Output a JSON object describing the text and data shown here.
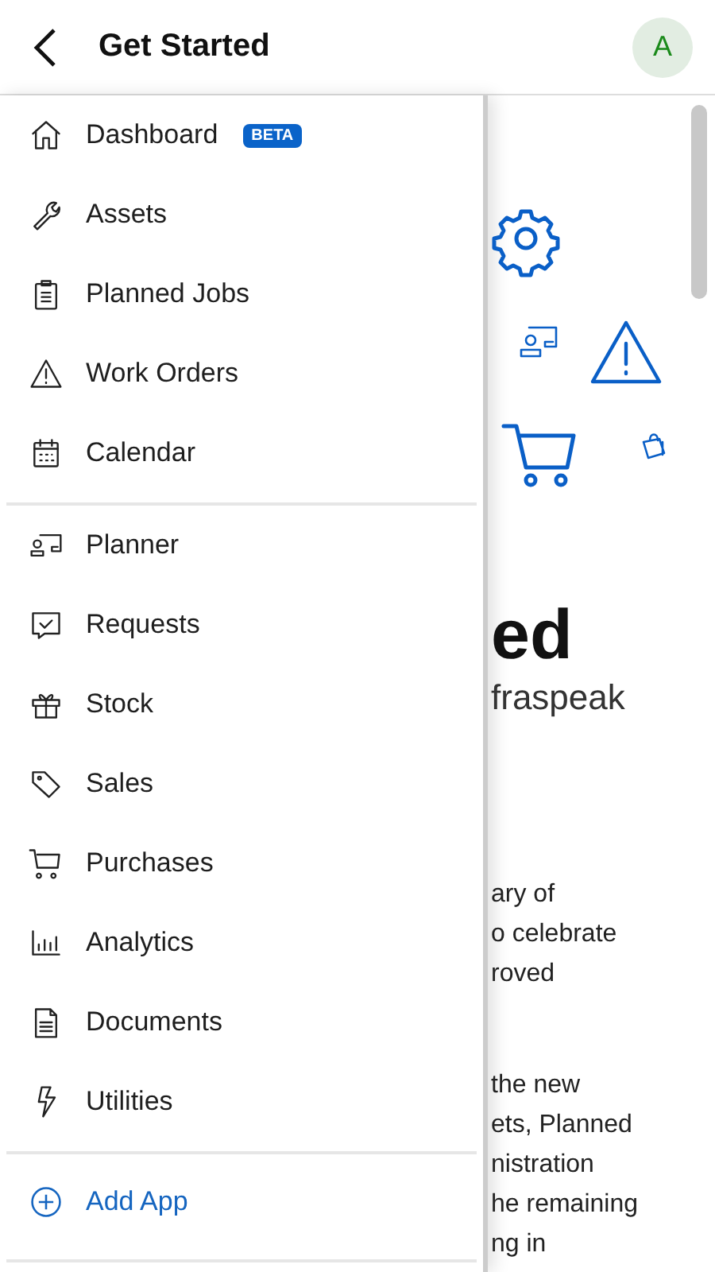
{
  "header": {
    "title": "Get Started",
    "avatar": "A"
  },
  "menu": {
    "sections": [
      {
        "items": [
          {
            "label": "Dashboard",
            "badge": "BETA"
          },
          {
            "label": "Assets"
          },
          {
            "label": "Planned Jobs"
          },
          {
            "label": "Work Orders"
          },
          {
            "label": "Calendar"
          }
        ]
      },
      {
        "items": [
          {
            "label": "Planner"
          },
          {
            "label": "Requests"
          },
          {
            "label": "Stock"
          },
          {
            "label": "Sales"
          },
          {
            "label": "Purchases"
          },
          {
            "label": "Analytics"
          },
          {
            "label": "Documents"
          },
          {
            "label": "Utilities"
          }
        ]
      }
    ],
    "add_app": "Add App"
  },
  "background_page": {
    "heading": "ed",
    "subheading": "fraspeak",
    "paragraph_1": [
      "ary of",
      "o celebrate",
      "roved"
    ],
    "paragraph_2": [
      "the new",
      "ets, Planned",
      "nistration",
      "he remaining",
      "ng in"
    ]
  }
}
